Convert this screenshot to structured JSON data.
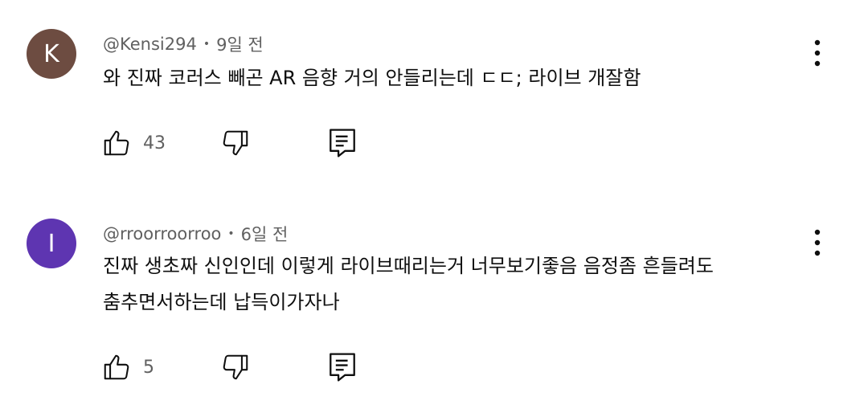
{
  "comments": [
    {
      "avatar_letter": "K",
      "avatar_color": "#6d4c41",
      "author": "@Kensi294",
      "separator": "•",
      "time": "9일 전",
      "text": "와 진짜 코러스 빼곤 AR 음향 거의 안들리는데 ㄷㄷ; 라이브 개잘함",
      "likes": "43"
    },
    {
      "avatar_letter": "I",
      "avatar_color": "#5e35b1",
      "author": "@rroorroorroo",
      "separator": "•",
      "time": "6일 전",
      "text": "진짜 생초짜 신인인데 이렇게 라이브때리는거 너무보기좋음 음정좀 흔들려도\n춤추면서하는데 납득이가자나",
      "likes": "5"
    }
  ],
  "icons": {
    "like": "thumbs-up-icon",
    "dislike": "thumbs-down-icon",
    "reply": "reply-icon",
    "more": "more-vertical-icon"
  }
}
